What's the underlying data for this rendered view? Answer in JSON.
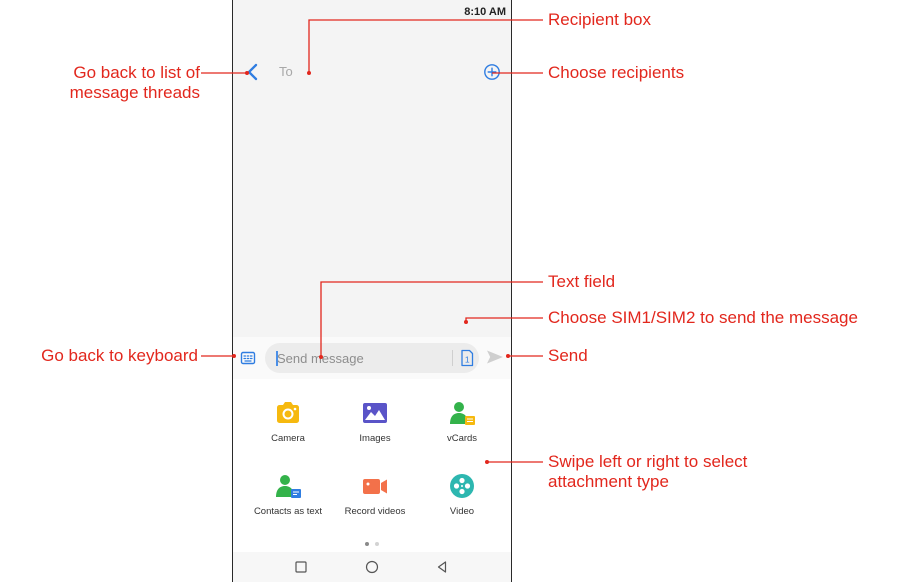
{
  "status_bar": {
    "time": "8:10 AM"
  },
  "header": {
    "to_placeholder": "To"
  },
  "compose": {
    "placeholder": "Send message",
    "sim_badge": "1"
  },
  "attachments": {
    "items": [
      {
        "label": "Camera",
        "icon": "camera-icon",
        "color": "#f6b90f"
      },
      {
        "label": "Images",
        "icon": "images-icon",
        "color": "#5a54c8"
      },
      {
        "label": "vCards",
        "icon": "vcard-icon",
        "color": "#33b24a"
      },
      {
        "label": "Contacts as text",
        "icon": "contact-text-icon",
        "color": "#33b24a"
      },
      {
        "label": "Record videos",
        "icon": "record-video-icon",
        "color": "#f3714a"
      },
      {
        "label": "Video",
        "icon": "video-icon",
        "color": "#2db7b0"
      }
    ],
    "pages": 2,
    "active_page": 1
  },
  "nav_bar": {
    "icons": [
      "recents-square-icon",
      "home-circle-icon",
      "back-triangle-icon"
    ]
  },
  "annotations": {
    "recipient_box": "Recipient box",
    "choose_recipients": "Choose recipients",
    "go_back_list_line1": "Go back to list of",
    "go_back_list_line2": "message threads",
    "text_field": "Text field",
    "choose_sim": "Choose SIM1/SIM2 to send the message",
    "go_back_keyboard": "Go back to keyboard",
    "send": "Send",
    "swipe_line1": "Swipe left or right to select",
    "swipe_line2": "attachment type"
  },
  "colors": {
    "annotation": "#e2271d",
    "accent_blue": "#2f7de1",
    "background": "#f4f4f4"
  }
}
